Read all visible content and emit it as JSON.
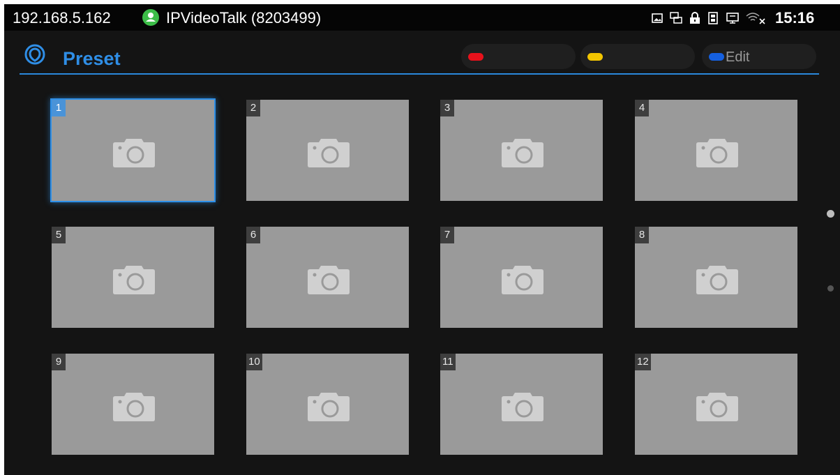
{
  "status_bar": {
    "ip": "192.168.5.162",
    "account": "IPVideoTalk (8203499)",
    "time": "15:16",
    "icons": [
      "picture-icon",
      "network-icon",
      "lock-icon",
      "sd-card-icon",
      "screen-share-icon",
      "wifi-off-icon"
    ]
  },
  "header": {
    "title": "Preset",
    "buttons": [
      {
        "label": "",
        "color": "#e8111b"
      },
      {
        "label": "",
        "color": "#f2c500"
      },
      {
        "label": "Edit",
        "color": "#1560e0"
      }
    ]
  },
  "presets": [
    {
      "number": "1",
      "selected": true
    },
    {
      "number": "2",
      "selected": false
    },
    {
      "number": "3",
      "selected": false
    },
    {
      "number": "4",
      "selected": false
    },
    {
      "number": "5",
      "selected": false
    },
    {
      "number": "6",
      "selected": false
    },
    {
      "number": "7",
      "selected": false
    },
    {
      "number": "8",
      "selected": false
    },
    {
      "number": "9",
      "selected": false
    },
    {
      "number": "10",
      "selected": false
    },
    {
      "number": "11",
      "selected": false
    },
    {
      "number": "12",
      "selected": false
    }
  ],
  "pager": {
    "current_page": 1,
    "total_pages": 2
  },
  "colors": {
    "accent": "#2f8ee6",
    "tile": "#9a9a9a",
    "background": "#141414"
  }
}
